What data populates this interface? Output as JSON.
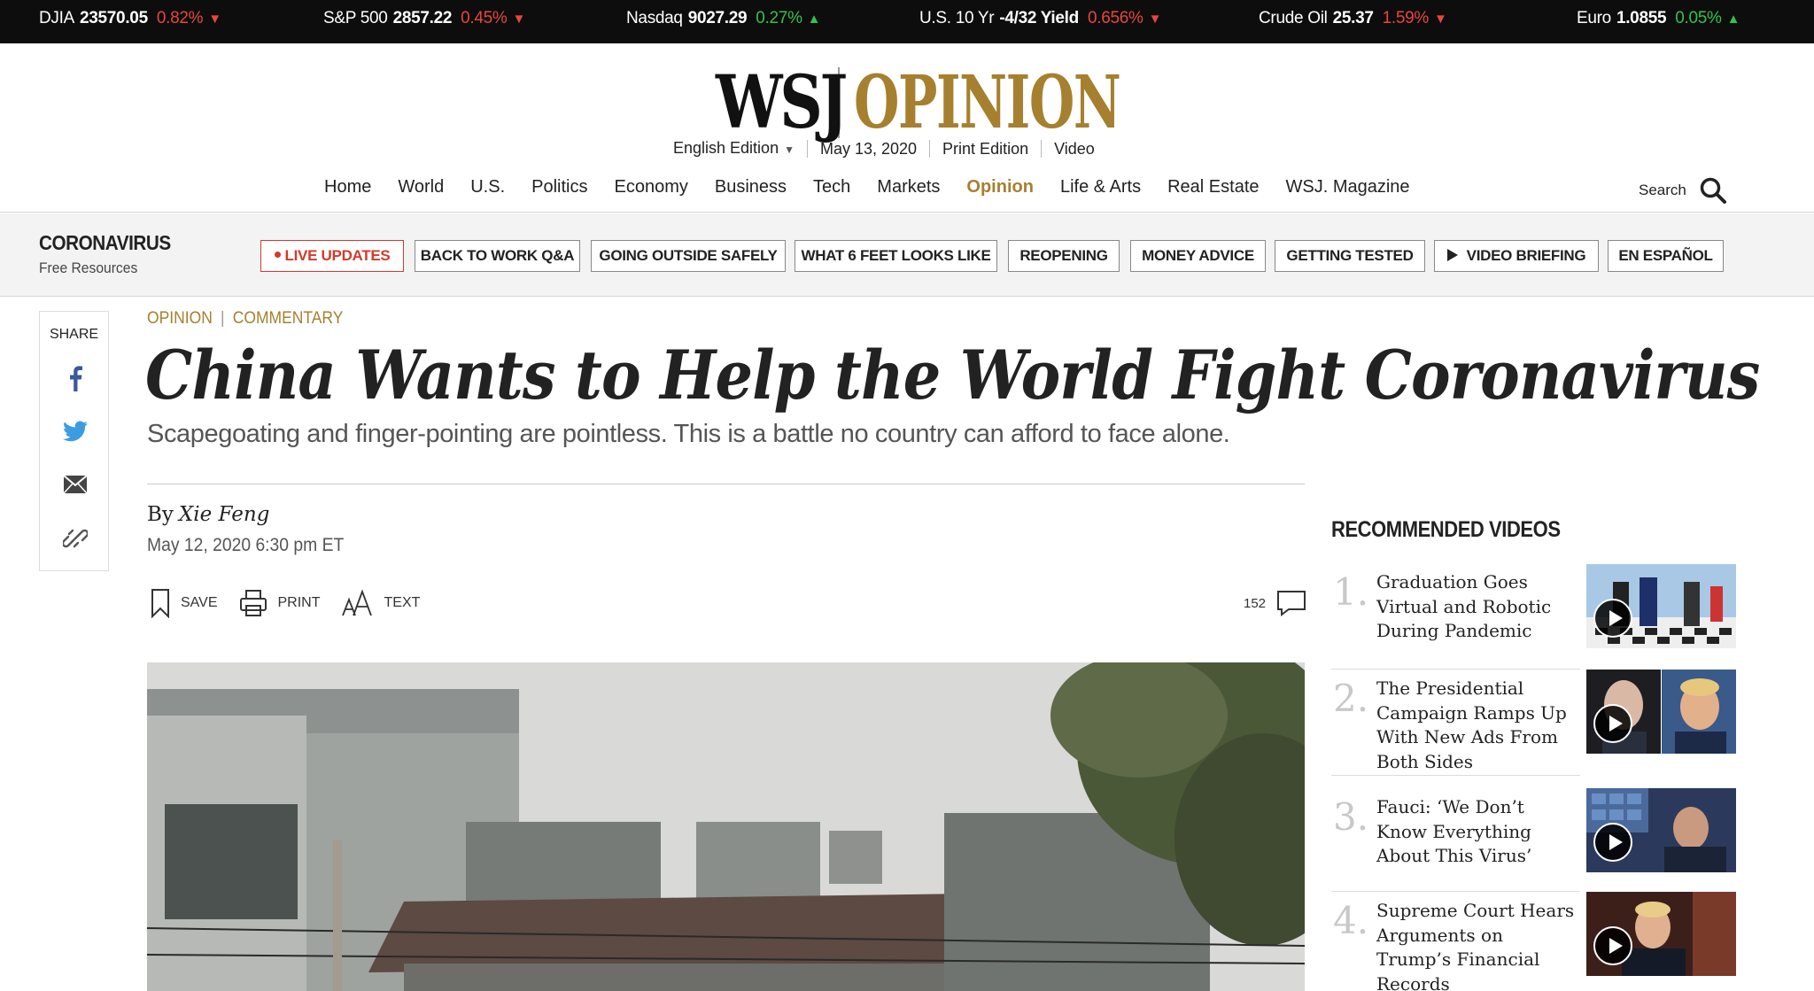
{
  "ticker": [
    {
      "name": "DJIA",
      "value": "23570.05",
      "change": "0.82%",
      "dir": "down"
    },
    {
      "name": "S&P 500",
      "value": "2857.22",
      "change": "0.45%",
      "dir": "down"
    },
    {
      "name": "Nasdaq",
      "value": "9027.29",
      "change": "0.27%",
      "dir": "up"
    },
    {
      "name": "U.S. 10 Yr",
      "value": "-4/32 Yield",
      "change": "0.656%",
      "dir": "down"
    },
    {
      "name": "Crude Oil",
      "value": "25.37",
      "change": "1.59%",
      "dir": "down"
    },
    {
      "name": "Euro",
      "value": "1.0855",
      "change": "0.05%",
      "dir": "up"
    }
  ],
  "masthead": {
    "logo_left": "WSJ",
    "logo_right": "OPINION",
    "edition": "English Edition",
    "date": "May 13, 2020",
    "print_edition": "Print Edition",
    "video": "Video"
  },
  "nav": {
    "items": [
      "Home",
      "World",
      "U.S.",
      "Politics",
      "Economy",
      "Business",
      "Tech",
      "Markets",
      "Opinion",
      "Life & Arts",
      "Real Estate",
      "WSJ. Magazine"
    ],
    "active": "Opinion",
    "search_label": "Search"
  },
  "coronavirus": {
    "title": "CORONAVIRUS",
    "subtitle": "Free Resources",
    "pills": [
      "LIVE UPDATES",
      "BACK TO WORK Q&A",
      "GOING OUTSIDE SAFELY",
      "WHAT 6 FEET LOOKS LIKE",
      "REOPENING",
      "MONEY ADVICE",
      "GETTING TESTED",
      "VIDEO BRIEFING",
      "EN ESPAÑOL"
    ]
  },
  "share": {
    "label": "SHARE"
  },
  "article": {
    "section": "OPINION",
    "subsection": "COMMENTARY",
    "headline": "China Wants to Help the World Fight Coronavirus",
    "dek": "Scapegoating and finger-pointing are pointless. This is a battle no country can afford to face alone.",
    "by": "By",
    "author": "Xie Feng",
    "date": "May 12, 2020 6:30 pm ET",
    "tools": {
      "save": "SAVE",
      "print": "PRINT",
      "text": "TEXT"
    },
    "comment_count": "152"
  },
  "sidebar": {
    "title": "RECOMMENDED VIDEOS",
    "videos": [
      {
        "num": "1.",
        "title": "Graduation Goes Virtual and Robotic During Pandemic"
      },
      {
        "num": "2.",
        "title": "The Presidential Campaign Ramps Up With New Ads From Both Sides"
      },
      {
        "num": "3.",
        "title": "Fauci: ‘We Don’t Know Everything About This Virus’"
      },
      {
        "num": "4.",
        "title": "Supreme Court Hears Arguments on Trump’s Financial Records"
      }
    ]
  },
  "colors": {
    "opinion_gold": "#a6802e",
    "ticker_down": "#e8463c",
    "ticker_up": "#33c24a",
    "live_red": "#d43a2b"
  }
}
